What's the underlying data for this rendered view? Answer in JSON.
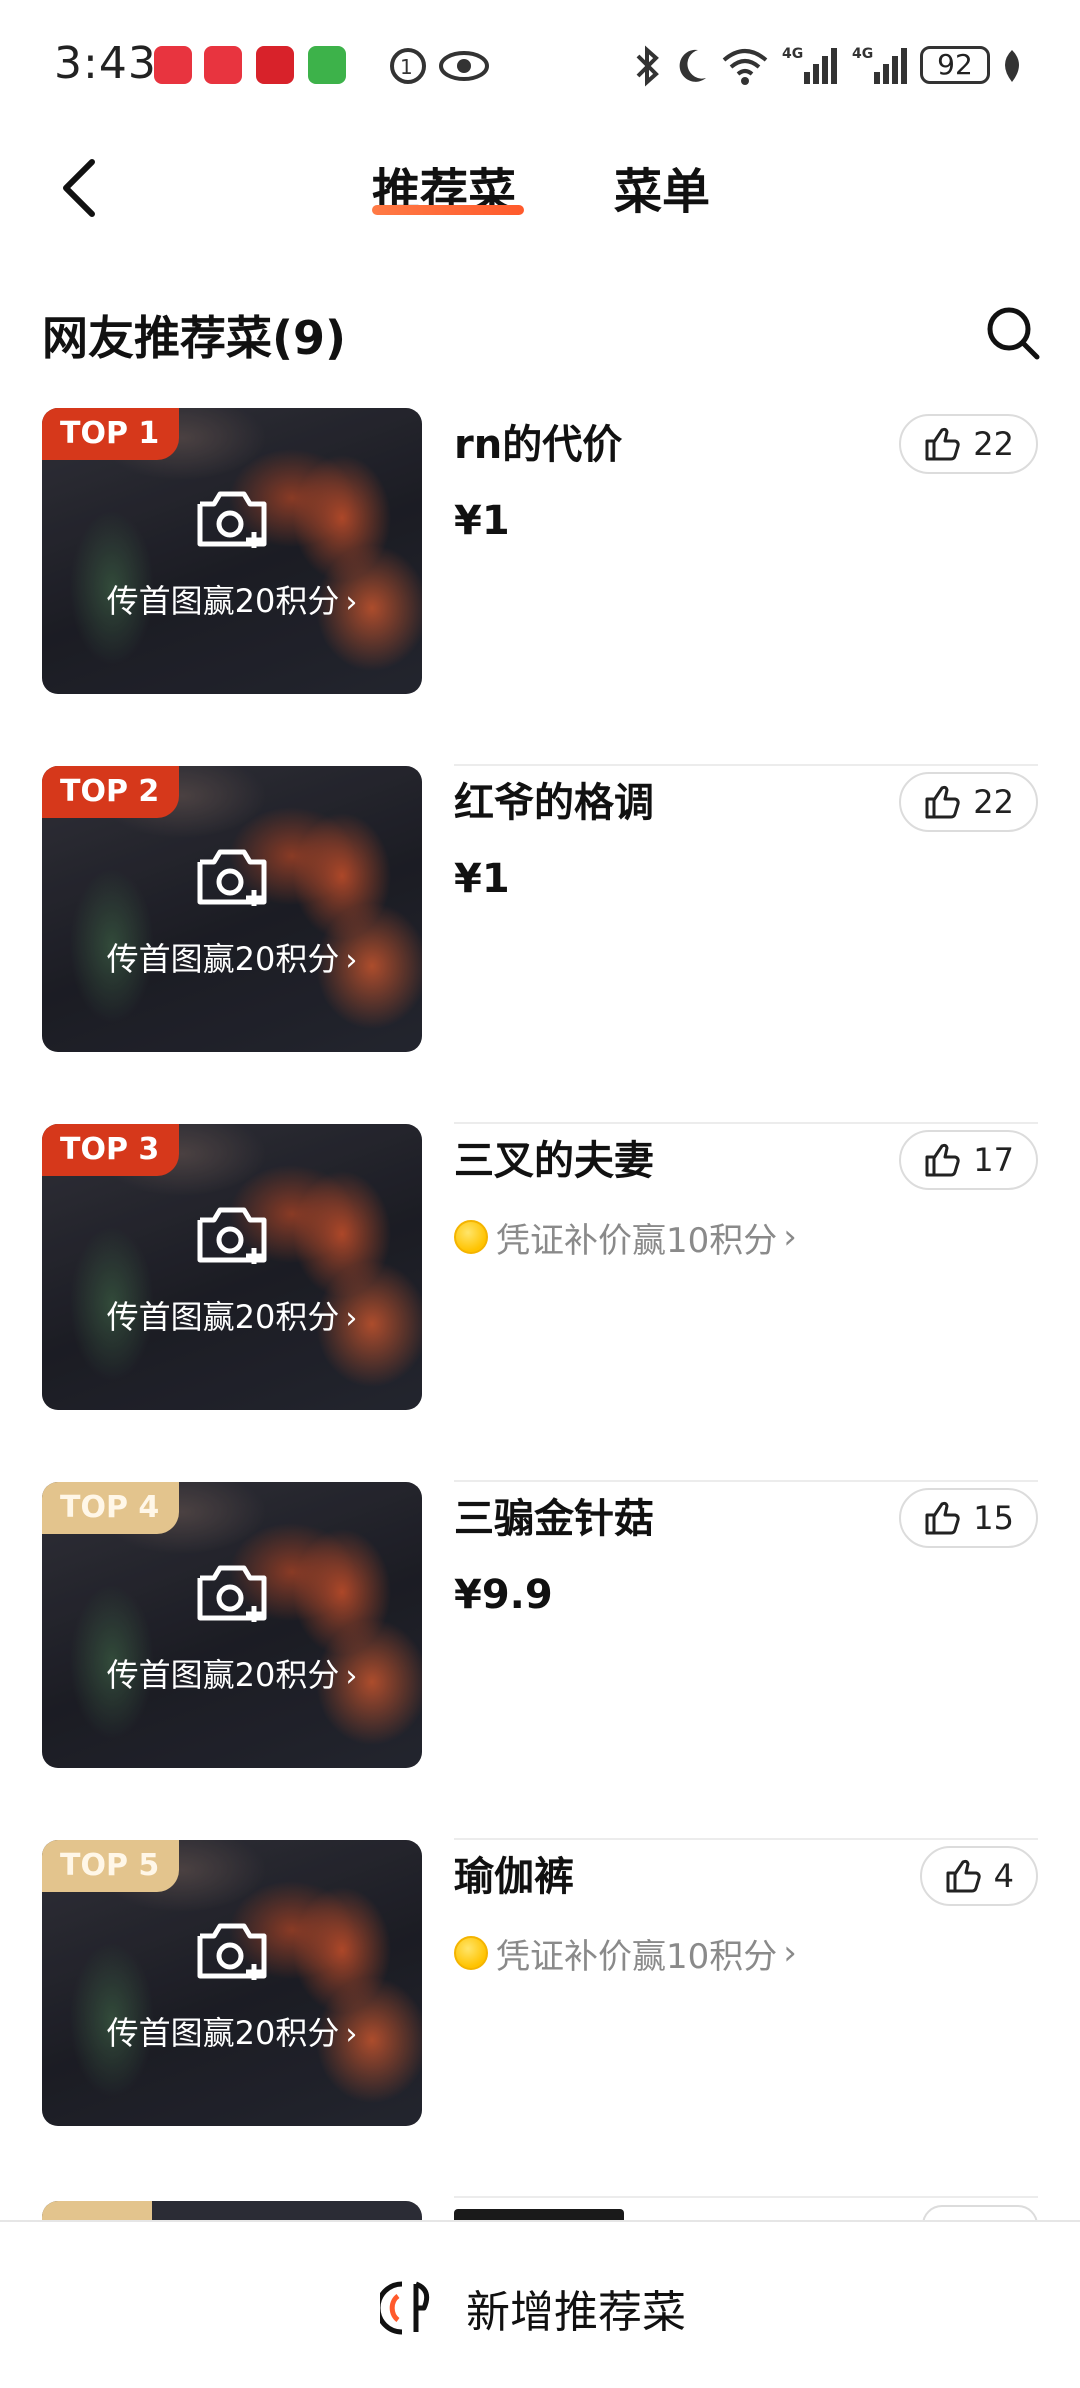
{
  "status_bar": {
    "time": "3:43",
    "battery": "92"
  },
  "header": {
    "tabs": [
      {
        "label": "推荐菜",
        "active": true
      },
      {
        "label": "菜单",
        "active": false
      }
    ]
  },
  "section": {
    "title": "网友推荐菜(9)"
  },
  "upload_prompt": "传首图赢20积分",
  "dishes": [
    {
      "rank": "TOP 1",
      "name": "rn的代价",
      "price": "¥1",
      "voucher": "",
      "likes": "22"
    },
    {
      "rank": "TOP 2",
      "name": "红爷的格调",
      "price": "¥1",
      "voucher": "",
      "likes": "22"
    },
    {
      "rank": "TOP 3",
      "name": "三叉的夫妻",
      "price": "",
      "voucher": "凭证补价赢10积分",
      "likes": "17"
    },
    {
      "rank": "TOP 4",
      "name": "三骟金针菇",
      "price": "¥9.9",
      "voucher": "",
      "likes": "15"
    },
    {
      "rank": "TOP 5",
      "name": "瑜伽裤",
      "price": "",
      "voucher": "凭证补价赢10积分",
      "likes": "4"
    }
  ],
  "bottom": {
    "add_label": "新增推荐菜"
  },
  "colors": {
    "accent": "#ff5a2c",
    "badge_top": "#d6381b",
    "badge_other": "#e3c48d",
    "voucher_text": "#8a8a8a"
  }
}
